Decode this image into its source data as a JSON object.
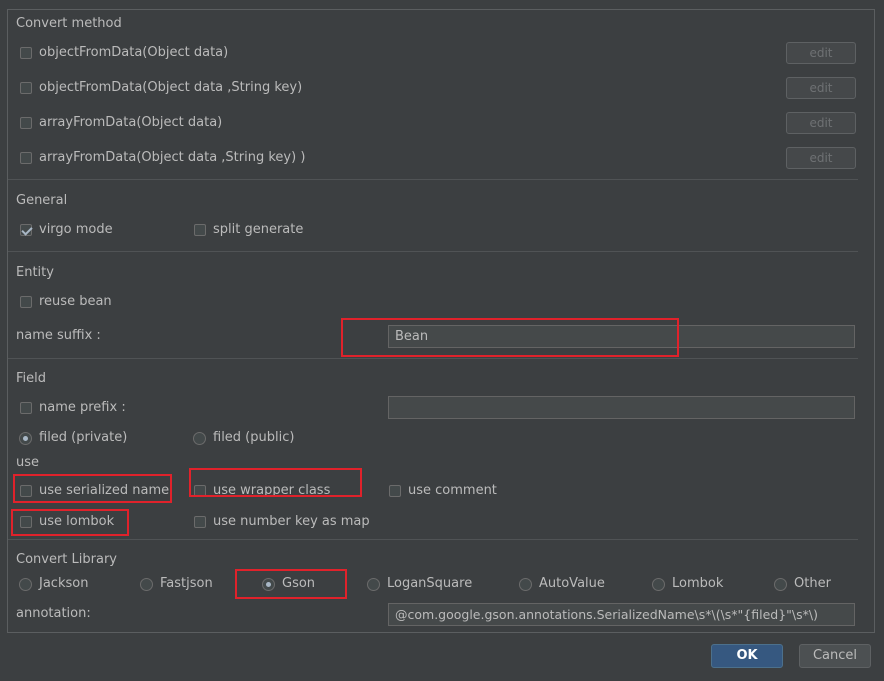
{
  "convert_method": {
    "title": "Convert method",
    "items": [
      {
        "label": "objectFromData(Object data)",
        "checked": false,
        "edit": "edit"
      },
      {
        "label": "objectFromData(Object data ,String key)",
        "checked": false,
        "edit": "edit"
      },
      {
        "label": "arrayFromData(Object data)",
        "checked": false,
        "edit": "edit"
      },
      {
        "label": "arrayFromData(Object data ,String key) )",
        "checked": false,
        "edit": "edit"
      }
    ]
  },
  "general": {
    "title": "General",
    "virgo_mode": {
      "label": "virgo mode",
      "checked": true
    },
    "split_generate": {
      "label": "split generate",
      "checked": false
    }
  },
  "entity": {
    "title": "Entity",
    "reuse_bean": {
      "label": "reuse bean",
      "checked": false
    },
    "name_suffix_label": "name suffix :",
    "name_suffix_value": "Bean"
  },
  "field": {
    "title": "Field",
    "name_prefix": {
      "label": "name prefix :",
      "checked": false,
      "value": ""
    },
    "filed_private": {
      "label": "filed (private)",
      "selected": true
    },
    "filed_public": {
      "label": "filed (public)",
      "selected": false
    },
    "use_title": "use",
    "use_serialized_name": {
      "label": "use serialized name",
      "checked": false
    },
    "use_wrapper_class": {
      "label": "use wrapper class",
      "checked": false
    },
    "use_comment": {
      "label": "use comment",
      "checked": false
    },
    "use_lombok": {
      "label": "use lombok",
      "checked": false
    },
    "use_number_key_as_map": {
      "label": "use number key as map",
      "checked": false
    }
  },
  "convert_library": {
    "title": "Convert Library",
    "options": [
      "Jackson",
      "Fastjson",
      "Gson",
      "LoganSquare",
      "AutoValue",
      "Lombok",
      "Other"
    ],
    "selected": "Gson",
    "annotation_label": "annotation:",
    "annotation_value": "@com.google.gson.annotations.SerializedName\\s*\\(\\s*\"{filed}\"\\s*\\)"
  },
  "buttons": {
    "ok": "OK",
    "cancel": "Cancel"
  },
  "colors": {
    "highlight": "#e0222b",
    "ok_button": "#365880",
    "background": "#3c3f41"
  }
}
